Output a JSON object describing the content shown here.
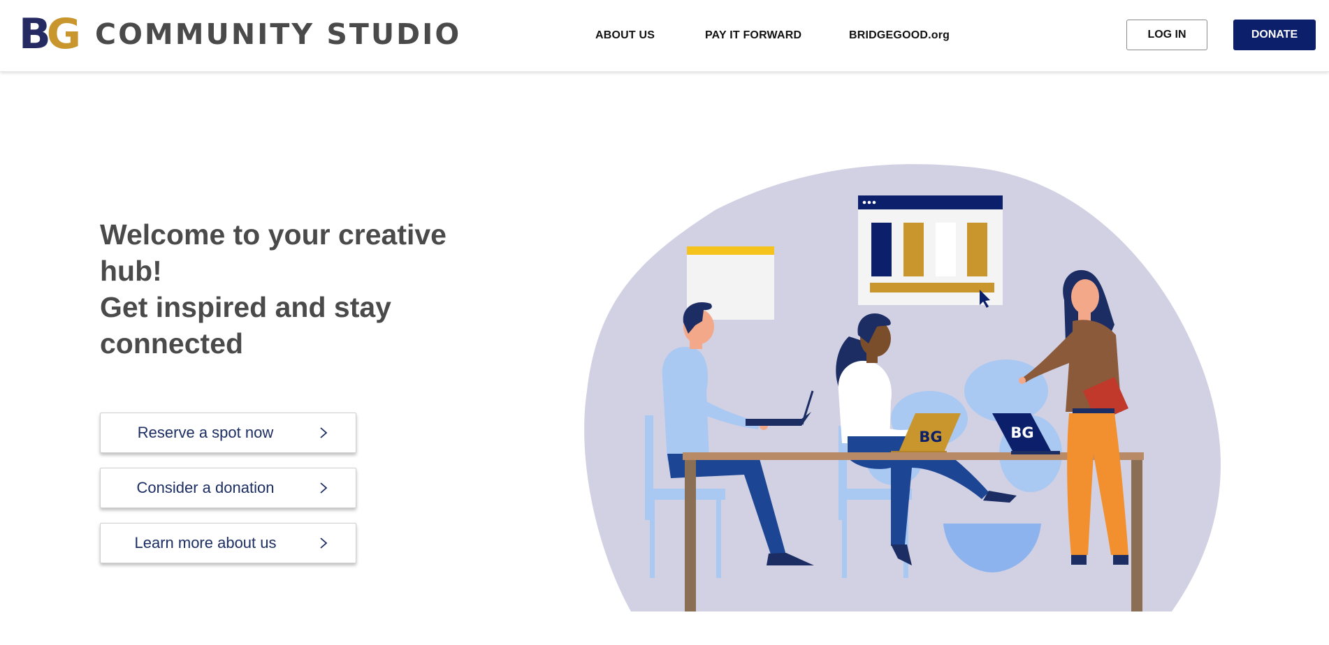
{
  "header": {
    "logo_mark_b": "B",
    "logo_mark_g": "G",
    "logo_text": "COMMUNITY STUDIO",
    "nav": [
      "ABOUT US",
      "PAY IT FORWARD",
      "BRIDGEGOOD.org"
    ],
    "login_label": "LOG IN",
    "donate_label": "DONATE"
  },
  "hero": {
    "headline_lines": [
      "Welcome to your creative hub!",
      "Get inspired and stay",
      "connected"
    ],
    "ctas": [
      "Reserve a spot now",
      "Consider a donation",
      "Learn more about us"
    ]
  },
  "illustration": {
    "laptop_logo_left": "BG",
    "laptop_logo_right": "BG"
  },
  "colors": {
    "navy": "#0b1f6b",
    "gold": "#c8962c",
    "blob": "#d2d1e3",
    "text_dark": "#4a4a4a"
  },
  "icons": [
    "chevron-right-icon",
    "cursor-icon"
  ]
}
